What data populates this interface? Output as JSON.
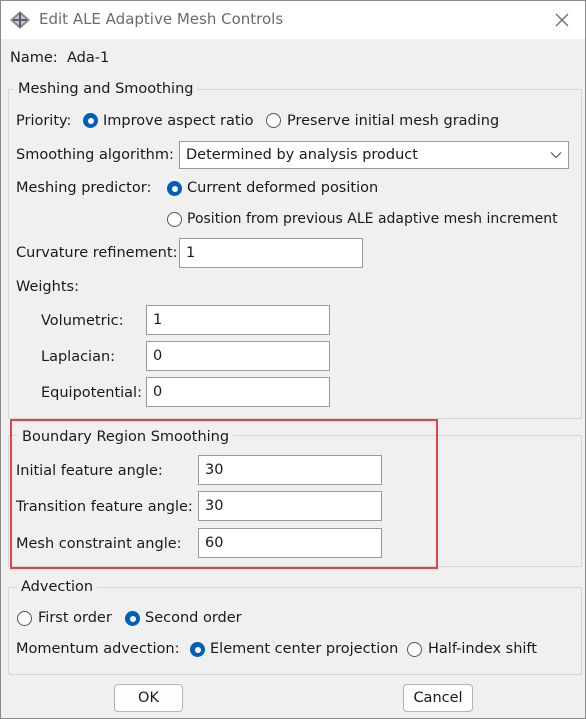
{
  "window": {
    "title": "Edit ALE Adaptive Mesh Controls",
    "app_icon": "abaqus-dialog-icon",
    "close_icon": "close-icon"
  },
  "name": {
    "label": "Name:",
    "value": "Ada-1"
  },
  "meshing": {
    "legend": "Meshing and Smoothing",
    "priority": {
      "label": "Priority:",
      "options": [
        "Improve aspect ratio",
        "Preserve initial mesh grading"
      ],
      "selected": 0
    },
    "smoothing_algorithm": {
      "label": "Smoothing algorithm:",
      "value": "Determined by analysis product"
    },
    "predictor": {
      "label": "Meshing predictor:",
      "options": [
        "Current deformed position",
        "Position from previous ALE adaptive mesh increment"
      ],
      "selected": 0
    },
    "curvature": {
      "label": "Curvature refinement:",
      "value": "1"
    },
    "weights": {
      "label": "Weights:",
      "volumetric": {
        "label": "Volumetric:",
        "value": "1"
      },
      "laplacian": {
        "label": "Laplacian:",
        "value": "0"
      },
      "equipotential": {
        "label": "Equipotential:",
        "value": "0"
      }
    }
  },
  "boundary": {
    "legend": "Boundary Region Smoothing",
    "initial": {
      "label": "Initial feature angle:",
      "value": "30"
    },
    "transition": {
      "label": "Transition feature angle:",
      "value": "30"
    },
    "constraint": {
      "label": "Mesh constraint angle:",
      "value": "60"
    },
    "highlight_color": "#e04545"
  },
  "advection": {
    "legend": "Advection",
    "order": {
      "options": [
        "First order",
        "Second order"
      ],
      "selected": 1
    },
    "momentum": {
      "label": "Momentum advection:",
      "options": [
        "Element center projection",
        "Half-index shift"
      ],
      "selected": 0
    }
  },
  "buttons": {
    "ok": "OK",
    "cancel": "Cancel"
  },
  "colors": {
    "radio_selected": "#005fb8",
    "highlight": "#e04545"
  }
}
